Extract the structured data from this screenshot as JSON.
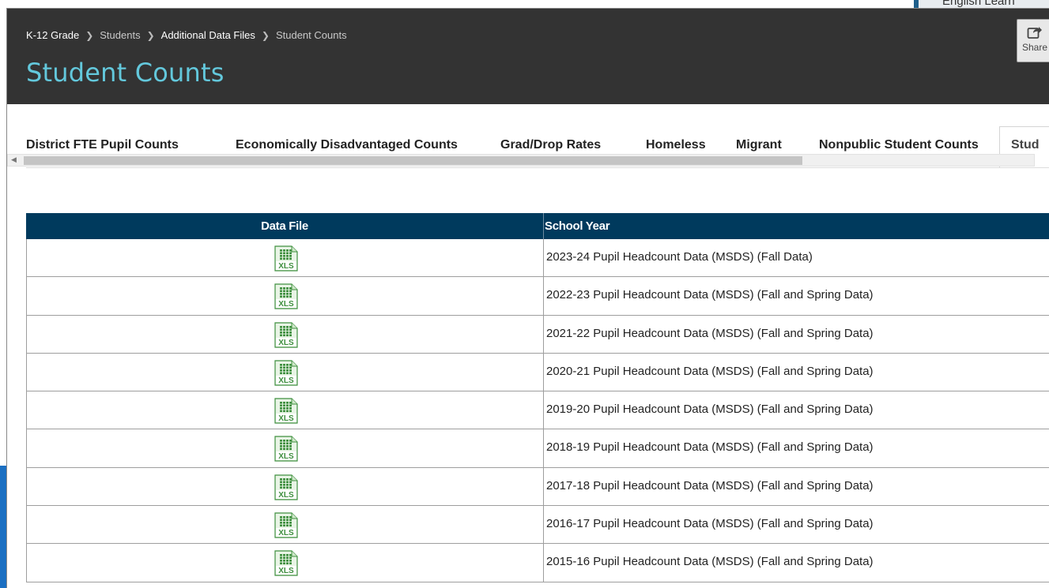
{
  "background": {
    "tab_label": "English Learn"
  },
  "breadcrumb": {
    "items": [
      "K-12 Grade",
      "Students",
      "Additional Data Files",
      "Student Counts"
    ]
  },
  "header": {
    "title": "Student Counts",
    "share_label": "Share"
  },
  "tabs": [
    "District FTE Pupil Counts",
    "Economically Disadvantaged Counts",
    "Grad/Drop Rates",
    "Homeless",
    "Migrant",
    "Nonpublic Student Counts",
    "Stud"
  ],
  "table": {
    "columns": [
      "Data File",
      "School Year"
    ],
    "rows": [
      {
        "file_icon": "xls-file-icon",
        "file_label": "XLS",
        "year": "2023-24 Pupil Headcount Data (MSDS) (Fall Data)"
      },
      {
        "file_icon": "xls-file-icon",
        "file_label": "XLS",
        "year": "2022-23 Pupil Headcount Data (MSDS) (Fall and Spring Data)"
      },
      {
        "file_icon": "xls-file-icon",
        "file_label": "XLS",
        "year": "2021-22 Pupil Headcount Data (MSDS) (Fall and Spring Data)"
      },
      {
        "file_icon": "xls-file-icon",
        "file_label": "XLS",
        "year": "2020-21 Pupil Headcount Data (MSDS) (Fall and Spring Data)"
      },
      {
        "file_icon": "xls-file-icon",
        "file_label": "XLS",
        "year": "2019-20 Pupil Headcount Data (MSDS) (Fall and Spring Data)"
      },
      {
        "file_icon": "xls-file-icon",
        "file_label": "XLS",
        "year": "2018-19 Pupil Headcount Data (MSDS) (Fall and Spring Data)"
      },
      {
        "file_icon": "xls-file-icon",
        "file_label": "XLS",
        "year": "2017-18 Pupil Headcount Data (MSDS) (Fall and Spring Data)"
      },
      {
        "file_icon": "xls-file-icon",
        "file_label": "XLS",
        "year": "2016-17 Pupil Headcount Data (MSDS) (Fall and Spring Data)"
      },
      {
        "file_icon": "xls-file-icon",
        "file_label": "XLS",
        "year": "2015-16 Pupil Headcount Data (MSDS) (Fall and Spring Data)"
      }
    ]
  },
  "colors": {
    "header_bg": "#333333",
    "title": "#63c8dc",
    "table_header_bg": "#003a5d",
    "xls_green": "#3f8f3f"
  }
}
